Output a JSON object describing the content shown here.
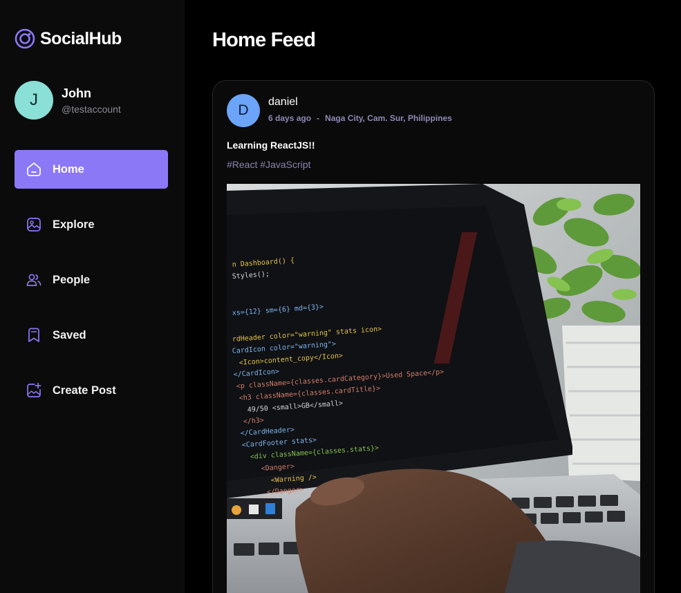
{
  "brand": {
    "name": "SocialHub",
    "accent": "#8b78f7"
  },
  "user": {
    "initial": "J",
    "name": "John",
    "handle": "@testaccount"
  },
  "nav": {
    "items": [
      {
        "label": "Home",
        "icon": "home-icon",
        "active": true
      },
      {
        "label": "Explore",
        "icon": "explore-icon",
        "active": false
      },
      {
        "label": "People",
        "icon": "people-icon",
        "active": false
      },
      {
        "label": "Saved",
        "icon": "bookmark-icon",
        "active": false
      },
      {
        "label": "Create Post",
        "icon": "create-post-icon",
        "active": false
      }
    ]
  },
  "page": {
    "title": "Home Feed"
  },
  "post": {
    "author_initial": "D",
    "author": "daniel",
    "time": "6 days ago",
    "separator": "-",
    "location": "Naga City, Cam. Sur, Philippines",
    "text": "Learning ReactJS!!",
    "tags": "#React #JavaScript",
    "image_alt": "laptop-with-code-editor-photo"
  }
}
